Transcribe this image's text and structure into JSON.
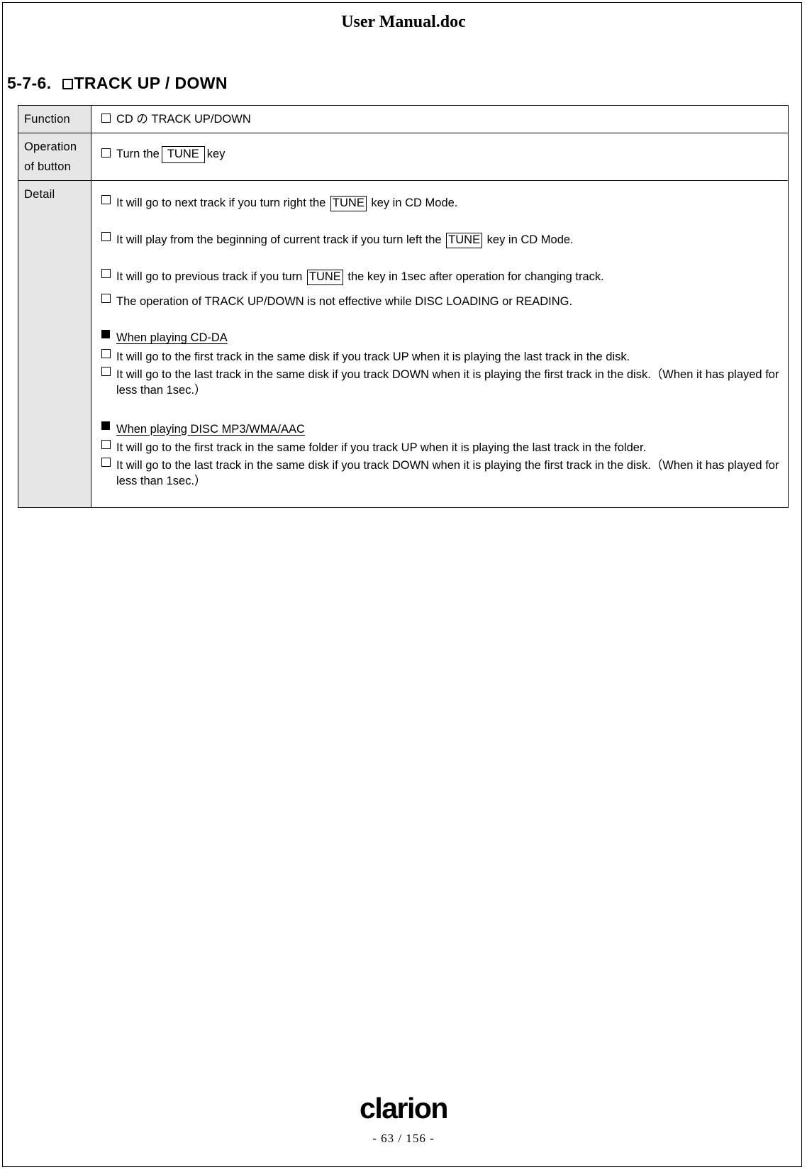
{
  "header": {
    "title": "User Manual.doc"
  },
  "section": {
    "number": "5-7-6.",
    "checkbox_icon": "empty-checkbox",
    "title": "TRACK UP / DOWN"
  },
  "table": {
    "rows": {
      "function": {
        "label": "Function",
        "items": [
          {
            "checkbox": "empty-checkbox",
            "text": "CD の TRACK UP/DOWN"
          }
        ]
      },
      "operation": {
        "label_line1": "Operation",
        "label_line2": "of button",
        "item": {
          "checkbox": "empty-checkbox",
          "text_before": "Turn the",
          "key": "TUNE",
          "text_after": "key"
        }
      },
      "detail": {
        "label": "Detail",
        "items": [
          {
            "checkbox": "empty-checkbox",
            "text_before": "It will go to next track if you turn right the",
            "key": "TUNE",
            "text_after": "key in CD Mode."
          },
          {
            "checkbox": "empty-checkbox",
            "text_before": "It will play from the beginning of current track if you turn left the",
            "key": "TUNE",
            "text_after": "key in CD Mode."
          },
          {
            "checkbox": "empty-checkbox",
            "text_before": "It will go to previous track if you turn",
            "key": "TUNE",
            "text_after": "the key in 1sec after operation for changing track."
          },
          {
            "checkbox": "empty-checkbox",
            "text": "The operation of TRACK UP/DOWN is not effective while DISC LOADING or READING."
          }
        ],
        "groups": [
          {
            "bullet": "filled-square-bullet",
            "title": "When playing CD-DA",
            "items": [
              {
                "checkbox": "empty-checkbox",
                "text": "It will go to the first track in the same disk if you track UP when it is playing the last track in the disk."
              },
              {
                "checkbox": "empty-checkbox",
                "text": "It will go to the last track in the same disk if you track DOWN when it is playing the first track in the disk.（When it has played for less than 1sec.）"
              }
            ]
          },
          {
            "bullet": "filled-square-bullet",
            "title": "When playing DISC MP3/WMA/AAC",
            "items": [
              {
                "checkbox": "empty-checkbox",
                "text": "It will go to the first track in the same folder if you track UP when it is playing the last track in the folder."
              },
              {
                "checkbox": "empty-checkbox",
                "text": "It will go to the last track in the same disk if you track DOWN when it is playing the first track in the disk.（When it has played for less than 1sec.）"
              }
            ]
          }
        ]
      }
    }
  },
  "footer": {
    "logo_text": "clarion",
    "page_number": "- 63 / 156 -"
  }
}
